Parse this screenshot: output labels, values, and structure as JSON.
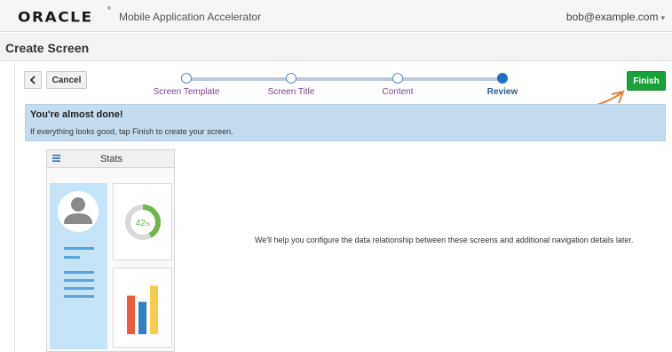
{
  "header": {
    "logo_text": "ORACLE",
    "logo_mark": "®",
    "app_title": "Mobile Application Accelerator",
    "user": "bob@example.com",
    "user_caret": "▾"
  },
  "page": {
    "title": "Create Screen"
  },
  "toolbar": {
    "back_icon": "chevron-left-icon",
    "cancel_label": "Cancel",
    "finish_label": "Finish"
  },
  "wizard": {
    "steps": [
      {
        "label": "Screen Template",
        "state": "visited"
      },
      {
        "label": "Screen Title",
        "state": "visited"
      },
      {
        "label": "Content",
        "state": "visited"
      },
      {
        "label": "Review",
        "state": "current"
      }
    ]
  },
  "banner": {
    "title": "You're almost done!",
    "text": "If everything looks good, tap Finish to create your screen."
  },
  "preview": {
    "title": "Stats",
    "menu_icon": "hamburger-icon",
    "donut_value": "42",
    "donut_unit": "%",
    "donut_percent": 42,
    "bars": [
      {
        "value": 0.62,
        "color": "#ee5a3a"
      },
      {
        "value": 0.52,
        "color": "#2f7fc1"
      },
      {
        "value": 0.78,
        "color": "#f8cc4a"
      }
    ]
  },
  "helper_text": "We'll help you configure the data relationship between these screens and additional navigation details later.",
  "colors": {
    "accent": "#1f6fc2",
    "finish": "#1aa23a",
    "banner": "#c5dcef",
    "step_label": "#7b3f8f",
    "annotation_arrow": "#e8823a"
  }
}
